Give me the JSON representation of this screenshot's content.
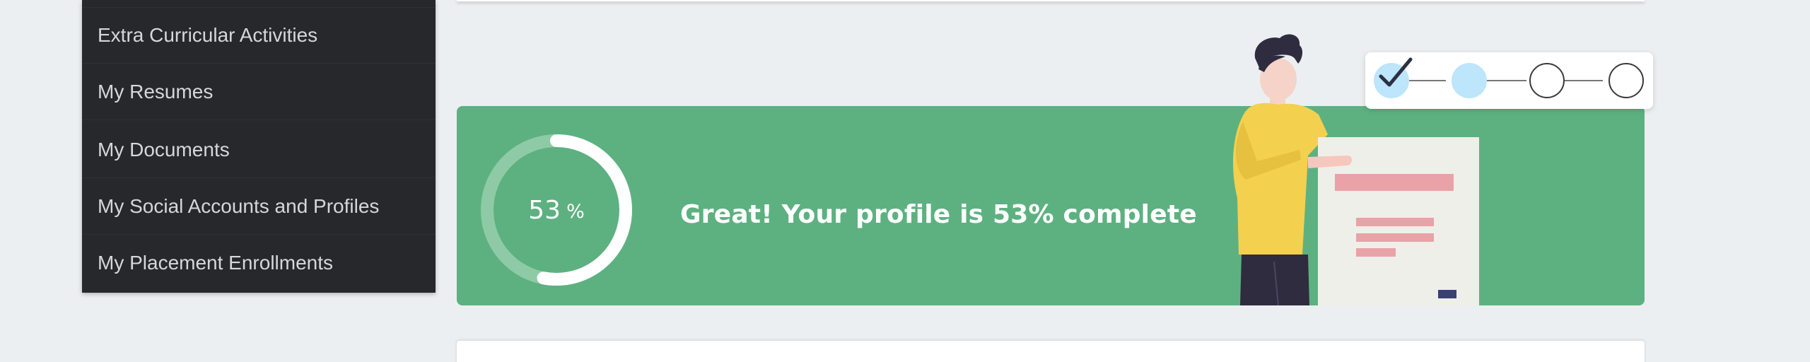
{
  "sidebar": {
    "items": [
      {
        "label": "Extra Curricular Activities"
      },
      {
        "label": "My Resumes"
      },
      {
        "label": "My Documents"
      },
      {
        "label": "My Social Accounts and Profiles"
      },
      {
        "label": "My Placement Enrollments"
      }
    ]
  },
  "profile_completion": {
    "percent": 53,
    "value_text": "53",
    "unit": "%",
    "message": "Great! Your profile is 53% complete"
  },
  "steps": {
    "total": 4,
    "completed": 1,
    "current": 2
  },
  "icons": {
    "check": "check-icon",
    "illustration": "person-with-document-illustration"
  },
  "colors": {
    "sidebar_bg": "#27282c",
    "sidebar_text": "#d5d7da",
    "banner_bg": "#5db181",
    "ring_track": "#8fcaa6",
    "ring_fill": "#ffffff",
    "step_done": "#bde5fb",
    "page_bg": "#eceff1"
  }
}
